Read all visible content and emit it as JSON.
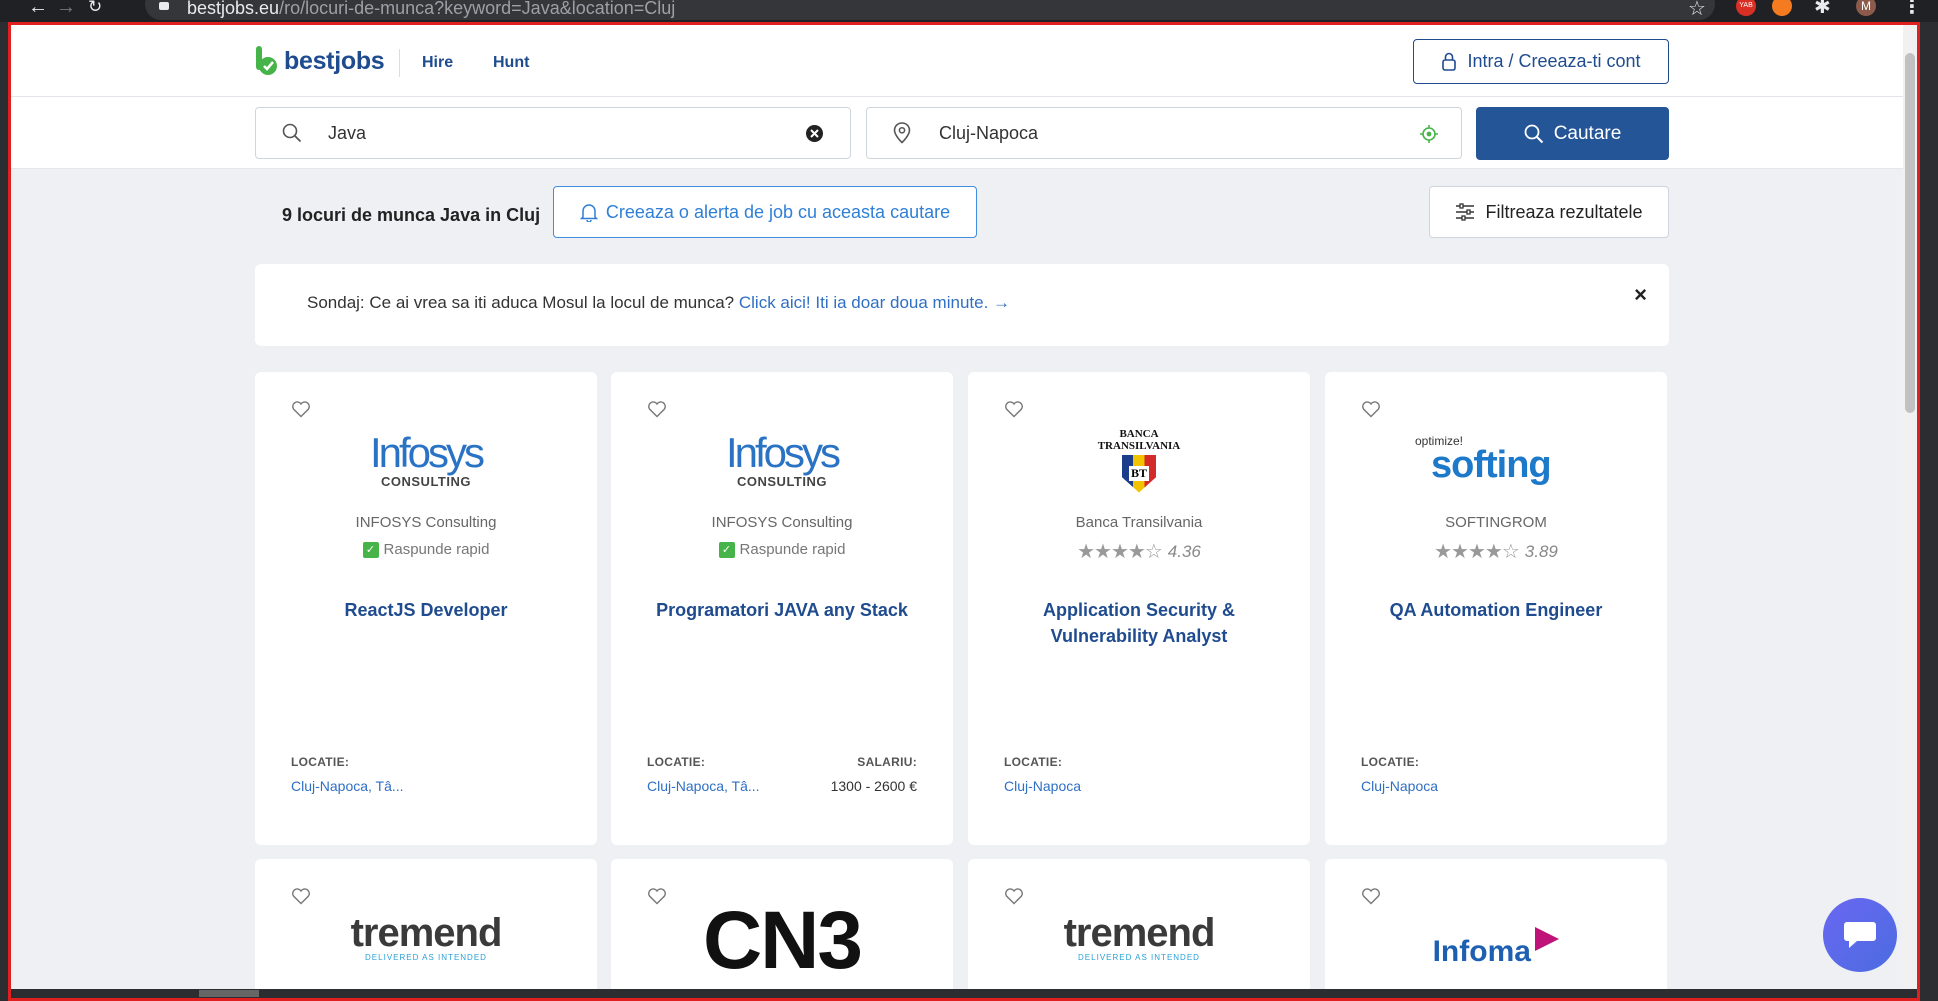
{
  "browser": {
    "url_host": "bestjobs.eu",
    "url_path": "/ro/locuri-de-munca?keyword=Java&location=Cluj",
    "avatar_letter": "M",
    "ext_badge": "YAB"
  },
  "header": {
    "logo_text": "bestjobs",
    "nav": [
      "Hire",
      "Hunt"
    ],
    "login_label": "Intra / Creeaza-ti cont"
  },
  "search": {
    "keyword_value": "Java",
    "location_value": "Cluj-Napoca",
    "button_label": "Cautare"
  },
  "results": {
    "count_text": "9 locuri de munca Java in Cluj",
    "alert_label": "Creeaza o alerta de job cu aceasta cautare",
    "filter_label": "Filtreaza rezultatele"
  },
  "survey": {
    "text": "Sondaj: Ce ai vrea sa iti aduca Mosul la locul de munca?",
    "link": "Click aici! Iti ia doar doua minute.",
    "close": "×"
  },
  "jobs": [
    {
      "company": "INFOSYS Consulting",
      "logo_text": "Infosys",
      "logo_sub": "CONSULTING",
      "badge": "Raspunde rapid",
      "title": "ReactJS Developer",
      "location_label": "LOCATIE:",
      "location": "Cluj-Napoca, Tâ..."
    },
    {
      "company": "INFOSYS Consulting",
      "logo_text": "Infosys",
      "logo_sub": "CONSULTING",
      "badge": "Raspunde rapid",
      "title": "Programatori JAVA any Stack",
      "location_label": "LOCATIE:",
      "location": "Cluj-Napoca, Tâ...",
      "salary_label": "SALARIU:",
      "salary": "1300 - 2600 €"
    },
    {
      "company": "Banca Transilvania",
      "logo_text": "BANCA TRANSILVANIA",
      "logo_sub": "BT",
      "rating": "4.36",
      "title_line1": "Application Security &",
      "title_line2": "Vulnerability Analyst",
      "location_label": "LOCATIE:",
      "location": "Cluj-Napoca"
    },
    {
      "company": "SOFTINGROM",
      "logo_text": "softing",
      "logo_sub": "optimize!",
      "rating": "3.89",
      "title": "QA Automation Engineer",
      "location_label": "LOCATIE:",
      "location": "Cluj-Napoca"
    }
  ],
  "jobs_row2": [
    {
      "logo_text": "tremend",
      "logo_sub": "DELIVERED AS INTENDED"
    },
    {
      "logo_text": "CN3"
    },
    {
      "logo_text": "tremend",
      "logo_sub": "DELIVERED AS INTENDED"
    },
    {
      "logo_text": "Infoma"
    }
  ],
  "colors": {
    "brand": "#1f4b8f",
    "search_button": "#245597",
    "link": "#2f6fc4",
    "badge_green": "#47b44a",
    "page_bg": "#eef0f3"
  }
}
